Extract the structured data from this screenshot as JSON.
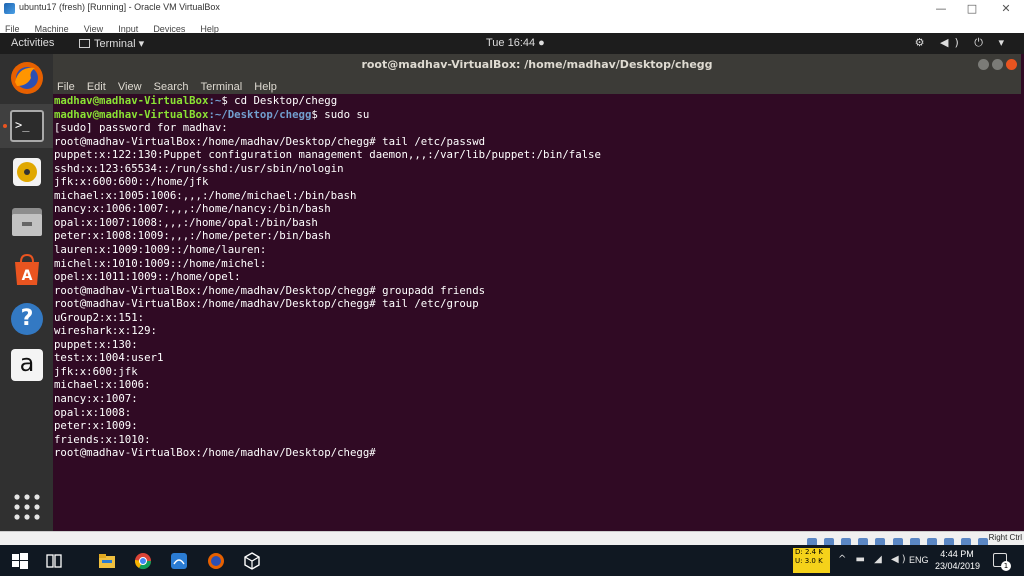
{
  "vbox": {
    "title": "ubuntu17 (fresh) [Running] - Oracle VM VirtualBox",
    "menu": [
      "File",
      "Machine",
      "View",
      "Input",
      "Devices",
      "Help"
    ],
    "window_buttons": [
      "—",
      "□",
      "✕"
    ],
    "host_key": "Right Ctrl"
  },
  "panel": {
    "activities": "Activities",
    "app_menu": "Terminal ▾",
    "clock": "Tue 16:44 ●",
    "tray": "⚙ ◀) ⏻ ▾"
  },
  "terminal": {
    "title": "root@madhav-VirtualBox: /home/madhav/Desktop/chegg",
    "menu": [
      "File",
      "Edit",
      "View",
      "Search",
      "Terminal",
      "Help"
    ],
    "lines": [
      {
        "user": "madhav@madhav-VirtualBox",
        "path": ":~",
        "cmd": "$ cd Desktop/chegg"
      },
      {
        "user": "madhav@madhav-VirtualBox",
        "path": ":~/Desktop/chegg",
        "cmd": "$ sudo su"
      },
      {
        "text": "[sudo] password for madhav:"
      },
      {
        "text": "root@madhav-VirtualBox:/home/madhav/Desktop/chegg# tail /etc/passwd"
      },
      {
        "text": "puppet:x:122:130:Puppet configuration management daemon,,,:/var/lib/puppet:/bin/false"
      },
      {
        "text": "sshd:x:123:65534::/run/sshd:/usr/sbin/nologin"
      },
      {
        "text": "jfk:x:600:600::/home/jfk"
      },
      {
        "text": "michael:x:1005:1006:,,,:/home/michael:/bin/bash"
      },
      {
        "text": "nancy:x:1006:1007:,,,:/home/nancy:/bin/bash"
      },
      {
        "text": "opal:x:1007:1008:,,,:/home/opal:/bin/bash"
      },
      {
        "text": "peter:x:1008:1009:,,,:/home/peter:/bin/bash"
      },
      {
        "text": "lauren:x:1009:1009::/home/lauren:"
      },
      {
        "text": "michel:x:1010:1009::/home/michel:"
      },
      {
        "text": "opel:x:1011:1009::/home/opel:"
      },
      {
        "text": "root@madhav-VirtualBox:/home/madhav/Desktop/chegg# groupadd friends"
      },
      {
        "text": "root@madhav-VirtualBox:/home/madhav/Desktop/chegg# tail /etc/group"
      },
      {
        "text": "uGroup2:x:151:"
      },
      {
        "text": "wireshark:x:129:"
      },
      {
        "text": "puppet:x:130:"
      },
      {
        "text": "test:x:1004:user1"
      },
      {
        "text": "jfk:x:600:jfk"
      },
      {
        "text": "michael:x:1006:"
      },
      {
        "text": "nancy:x:1007:"
      },
      {
        "text": "opal:x:1008:"
      },
      {
        "text": "peter:x:1009:"
      },
      {
        "text": "friends:x:1010:"
      },
      {
        "text": "root@madhav-VirtualBox:/home/madhav/Desktop/chegg# "
      }
    ]
  },
  "dock": {
    "items": [
      "firefox-icon",
      "terminal-icon",
      "rhythmbox-icon",
      "files-icon",
      "software-center-icon",
      "help-icon",
      "amazon-icon",
      "show-apps-icon"
    ],
    "help_glyph": "?",
    "amazon_glyph": "a",
    "terminal_glyph": ">_"
  },
  "taskbar": {
    "net_down": "D: 2.4 K",
    "net_up": "U: 3.0 K",
    "systray": "^ ▬ ◢ ◀)",
    "lang": "ENG",
    "time": "4:44 PM",
    "date": "23/04/2019",
    "notification_count": "1"
  },
  "colors": {
    "terminal_bg": "#300a24",
    "prompt_user": "#8ae234",
    "prompt_path": "#729fcf",
    "ubuntu_orange": "#e95420"
  }
}
